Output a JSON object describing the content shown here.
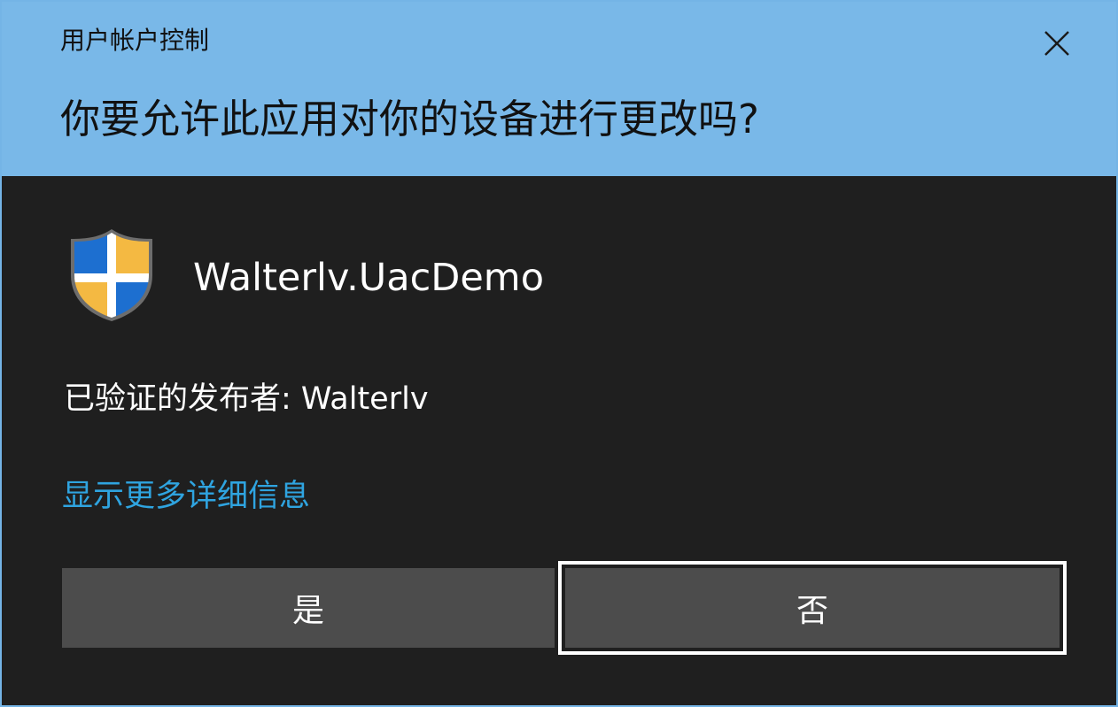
{
  "dialog": {
    "title": "用户帐户控制",
    "question": "你要允许此应用对你的设备进行更改吗?",
    "close_icon": "close-icon",
    "header_color": "#79b8e8",
    "body_color": "#1f1f1f"
  },
  "app": {
    "icon": "shield-icon",
    "name": "Walterlv.UacDemo",
    "publisher_label": "已验证的发布者: Walterlv"
  },
  "details_link": {
    "label": "显示更多详细信息",
    "color": "#2fa4e0"
  },
  "buttons": {
    "yes_label": "是",
    "no_label": "否"
  }
}
